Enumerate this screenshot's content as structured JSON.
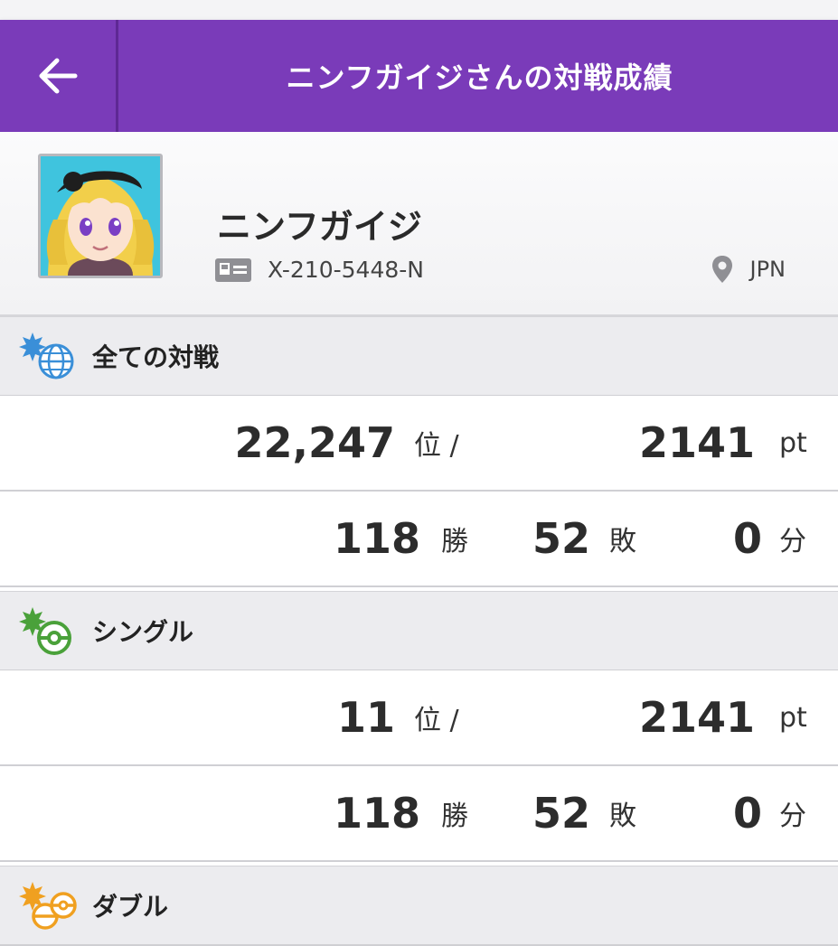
{
  "header": {
    "title": "ニンフガイジさんの対戦成績"
  },
  "profile": {
    "name": "ニンフガイジ",
    "player_id": "X-210-5448-N",
    "location": "JPN"
  },
  "sections": [
    {
      "label": "全ての対戦",
      "icon": "globe-icon",
      "rank": "22,247",
      "rank_unit": "位 /",
      "points": "2141",
      "points_unit": "pt",
      "wins": "118",
      "wins_unit": "勝",
      "losses": "52",
      "losses_unit": "敗",
      "draws": "0",
      "draws_unit": "分"
    },
    {
      "label": "シングル",
      "icon": "single-battle-icon",
      "rank": "11",
      "rank_unit": "位 /",
      "points": "2141",
      "points_unit": "pt",
      "wins": "118",
      "wins_unit": "勝",
      "losses": "52",
      "losses_unit": "敗",
      "draws": "0",
      "draws_unit": "分"
    },
    {
      "label": "ダブル",
      "icon": "double-battle-icon"
    }
  ],
  "colors": {
    "header": "#7a3bb9",
    "single_accent": "#4aa13a",
    "double_accent": "#f0a020",
    "all_accent": "#3a8fd8"
  }
}
